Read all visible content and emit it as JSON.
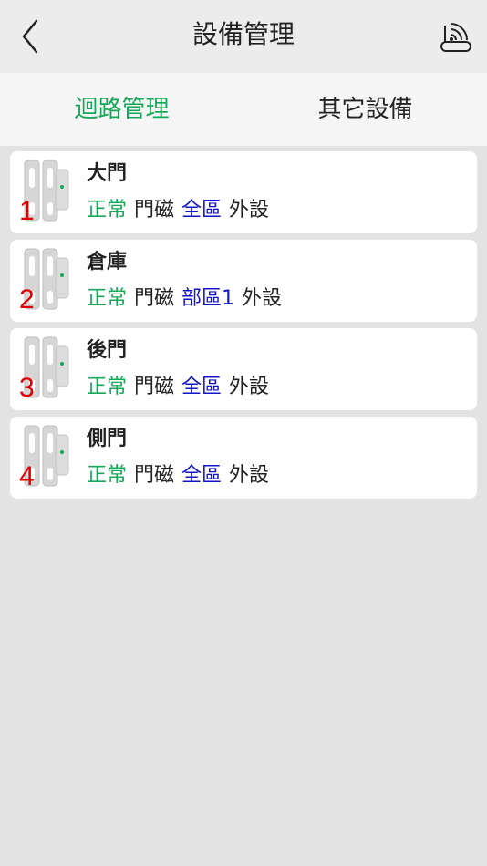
{
  "header": {
    "title": "設備管理",
    "back_icon": "chevron-left-icon",
    "signal_icon": "wireless-signal-icon"
  },
  "tabs": [
    {
      "label": "迴路管理",
      "active": true
    },
    {
      "label": "其它設備",
      "active": false
    }
  ],
  "colors": {
    "active_tab": "#17a85a",
    "inactive_tab": "#222222",
    "status_green": "#17a85a",
    "zone_blue": "#1515c8",
    "number_red": "#e10000"
  },
  "devices": [
    {
      "number": "1",
      "name": "大門",
      "status": "正常",
      "type": "門磁",
      "zone": "全區",
      "location": "外設"
    },
    {
      "number": "2",
      "name": "倉庫",
      "status": "正常",
      "type": "門磁",
      "zone": "部區1",
      "location": "外設"
    },
    {
      "number": "3",
      "name": "後門",
      "status": "正常",
      "type": "門磁",
      "zone": "全區",
      "location": "外設"
    },
    {
      "number": "4",
      "name": "側門",
      "status": "正常",
      "type": "門磁",
      "zone": "全區",
      "location": "外設"
    }
  ]
}
